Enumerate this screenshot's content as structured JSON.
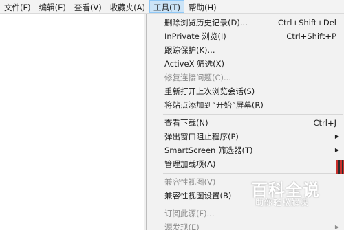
{
  "menubar": {
    "items": [
      "文件(F)",
      "编辑(E)",
      "查看(V)",
      "收藏夹(A)",
      "工具(T)",
      "帮助(H)"
    ]
  },
  "tools_menu": {
    "items": [
      {
        "label": "删除浏览历史记录(D)...",
        "shortcut": "Ctrl+Shift+Del"
      },
      {
        "label": "InPrivate 浏览(I)",
        "shortcut": "Ctrl+Shift+P"
      },
      {
        "label": "跟踪保护(K)...",
        "shortcut": ""
      },
      {
        "label": "ActiveX 筛选(X)",
        "shortcut": ""
      },
      {
        "label": "修复连接问题(C)...",
        "shortcut": "",
        "disabled": true
      },
      {
        "label": "重新打开上次浏览会话(S)",
        "shortcut": ""
      },
      {
        "label": "将站点添加到“开始”屏幕(R)",
        "shortcut": ""
      },
      {
        "label": "查看下载(N)",
        "shortcut": "Ctrl+J"
      },
      {
        "label": "弹出窗口阻止程序(P)",
        "shortcut": "",
        "submenu": true
      },
      {
        "label": "SmartScreen 筛选器(T)",
        "shortcut": "",
        "submenu": true
      },
      {
        "label": "管理加载项(A)",
        "shortcut": ""
      },
      {
        "label": "兼容性视图(V)",
        "shortcut": "",
        "disabled": true
      },
      {
        "label": "兼容性视图设置(B)",
        "shortcut": ""
      },
      {
        "label": "订阅此源(F)...",
        "shortcut": "",
        "disabled": true
      },
      {
        "label": "源发现(E)",
        "shortcut": "",
        "disabled": true,
        "submenu": true
      }
    ]
  },
  "watermark": {
    "title": "百科全说",
    "subtitle": "助你轻松解决"
  }
}
